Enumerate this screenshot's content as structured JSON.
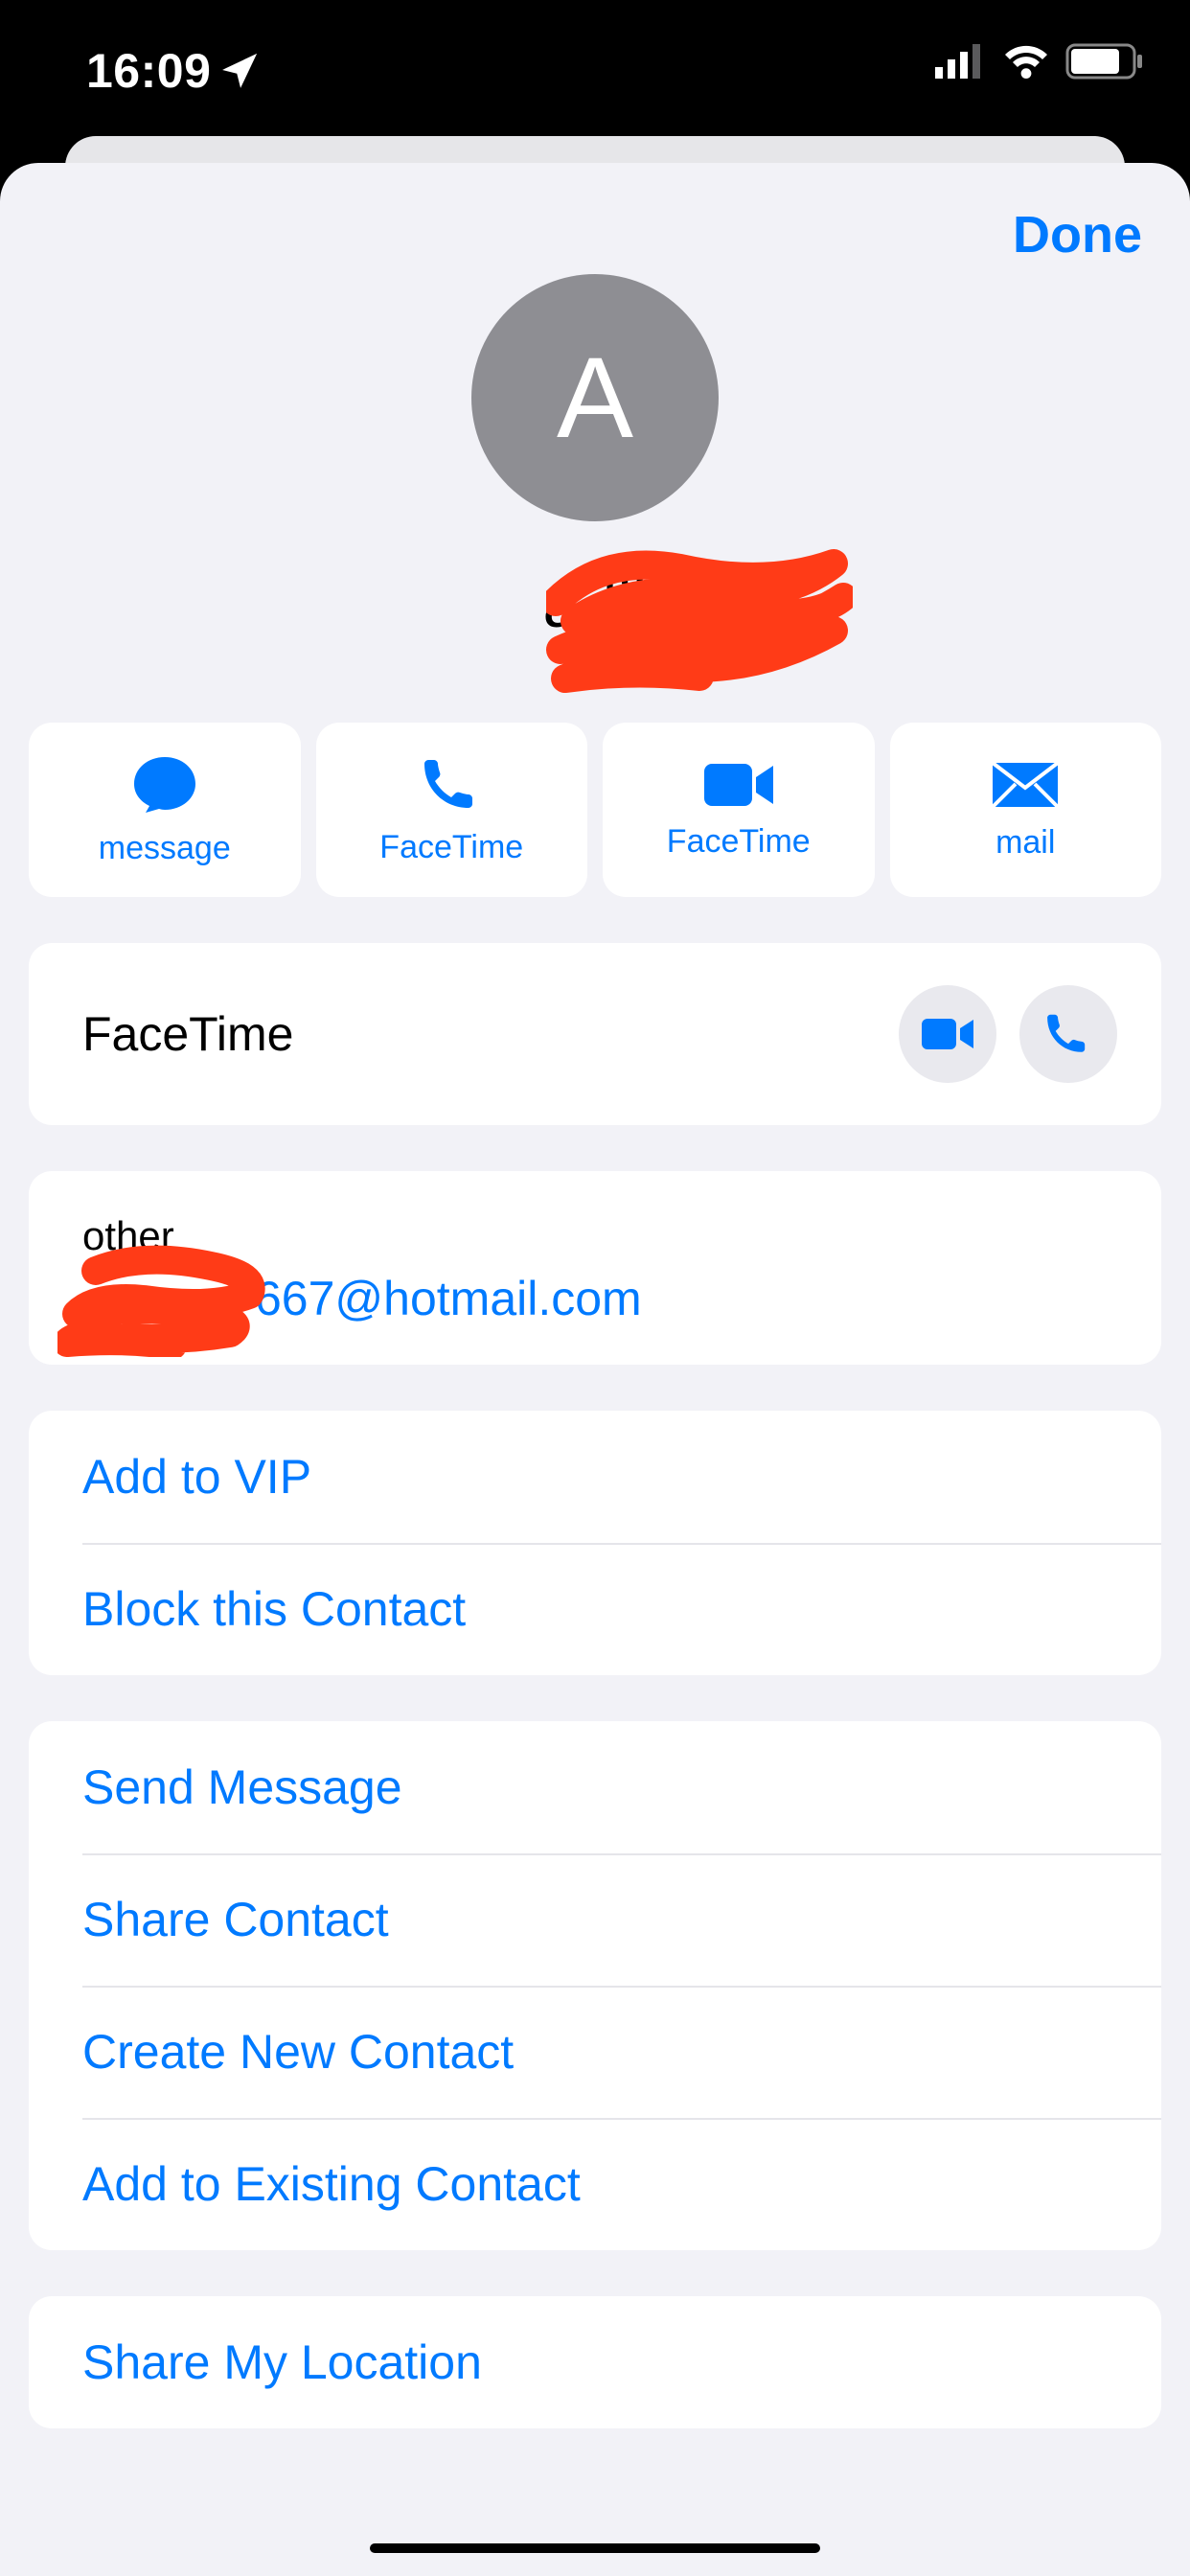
{
  "status": {
    "time": "16:09"
  },
  "nav": {
    "done": "Done"
  },
  "avatar": {
    "initial": "A"
  },
  "contact": {
    "name": "a-lil"
  },
  "chips": {
    "message": "message",
    "facetime_audio": "FaceTime",
    "facetime_video": "FaceTime",
    "mail": "mail"
  },
  "facetime_row": {
    "label": "FaceTime"
  },
  "email_row": {
    "label": "other",
    "value_visible": "667@hotmail.com"
  },
  "actions1": {
    "vip": "Add to VIP",
    "block": "Block this Contact"
  },
  "actions2": {
    "send": "Send Message",
    "share": "Share Contact",
    "create": "Create New Contact",
    "add_existing": "Add to Existing Contact"
  },
  "actions3": {
    "share_loc": "Share My Location"
  },
  "colors": {
    "accent": "#007aff",
    "scribble": "#ff3b17"
  }
}
